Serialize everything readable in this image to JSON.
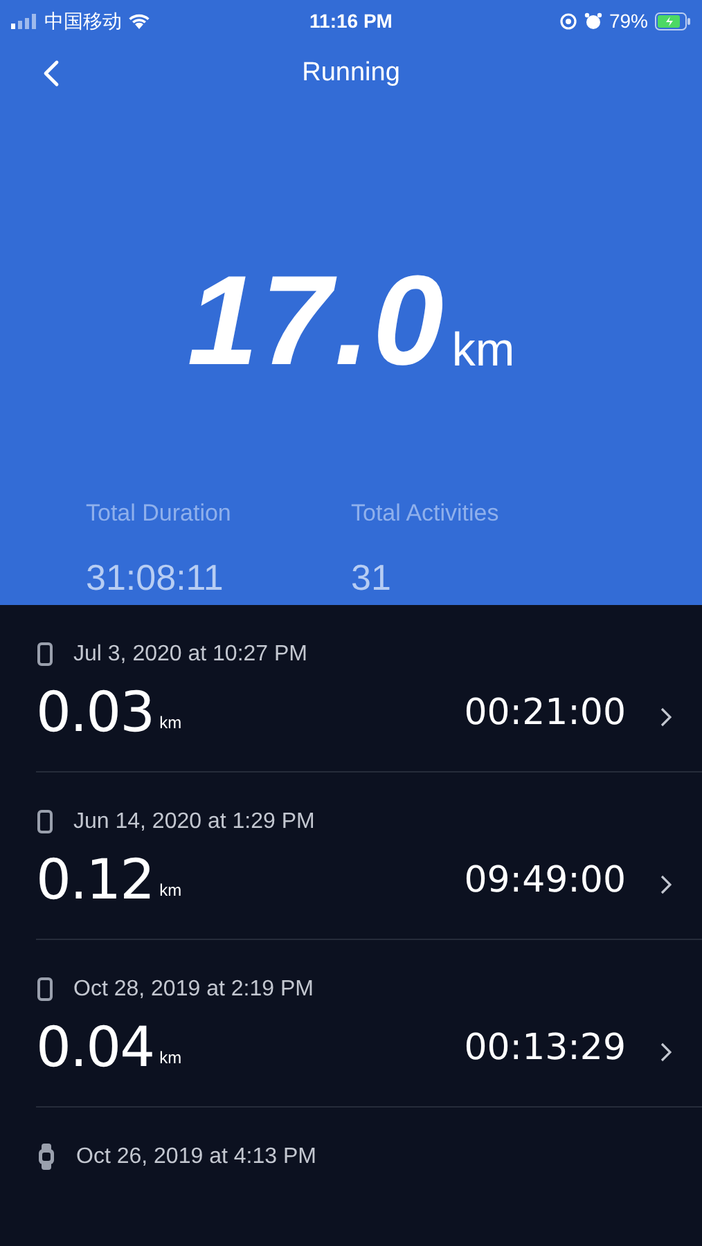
{
  "status_bar": {
    "carrier": "中国移动",
    "time": "11:16 PM",
    "battery": "79%"
  },
  "header": {
    "title": "Running"
  },
  "summary": {
    "distance": "17.0",
    "unit": "km",
    "stats": [
      {
        "label": "Total Duration",
        "value": "31:08:11"
      },
      {
        "label": "Total Activities",
        "value": "31"
      }
    ]
  },
  "activities": [
    {
      "kind": "phone",
      "date": "Jul 3, 2020 at 10:27 PM",
      "distance": "0.03",
      "unit": "km",
      "duration": "00:21:00"
    },
    {
      "kind": "phone",
      "date": "Jun 14, 2020 at 1:29 PM",
      "distance": "0.12",
      "unit": "km",
      "duration": "09:49:00"
    },
    {
      "kind": "phone",
      "date": "Oct 28, 2019 at 2:19 PM",
      "distance": "0.04",
      "unit": "km",
      "duration": "00:13:29"
    },
    {
      "kind": "watch",
      "date": "Oct 26, 2019 at 4:13 PM"
    }
  ]
}
